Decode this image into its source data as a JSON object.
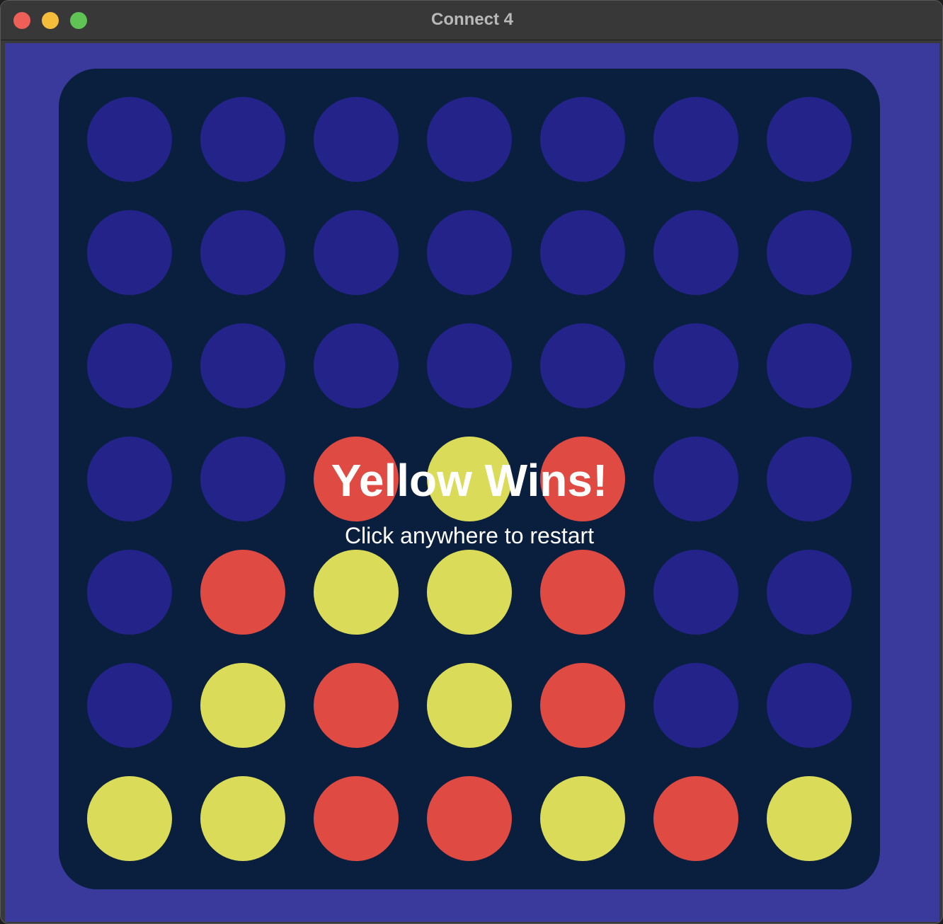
{
  "window": {
    "title": "Connect 4"
  },
  "colors": {
    "empty": "#23238a",
    "red": "#df4a42",
    "yellow": "#dadb58",
    "board": "#0a1f3e",
    "background": "#3a3a9c"
  },
  "board": {
    "rows": 7,
    "cols": 7,
    "cells": [
      [
        "empty",
        "empty",
        "empty",
        "empty",
        "empty",
        "empty",
        "empty"
      ],
      [
        "empty",
        "empty",
        "empty",
        "empty",
        "empty",
        "empty",
        "empty"
      ],
      [
        "empty",
        "empty",
        "empty",
        "empty",
        "empty",
        "empty",
        "empty"
      ],
      [
        "empty",
        "empty",
        "red",
        "yellow",
        "red",
        "empty",
        "empty"
      ],
      [
        "empty",
        "red",
        "yellow",
        "yellow",
        "red",
        "empty",
        "empty"
      ],
      [
        "empty",
        "yellow",
        "red",
        "yellow",
        "red",
        "empty",
        "empty"
      ],
      [
        "yellow",
        "yellow",
        "red",
        "red",
        "yellow",
        "red",
        "yellow"
      ]
    ]
  },
  "overlay": {
    "message": "Yellow Wins!",
    "hint": "Click anywhere to restart"
  }
}
